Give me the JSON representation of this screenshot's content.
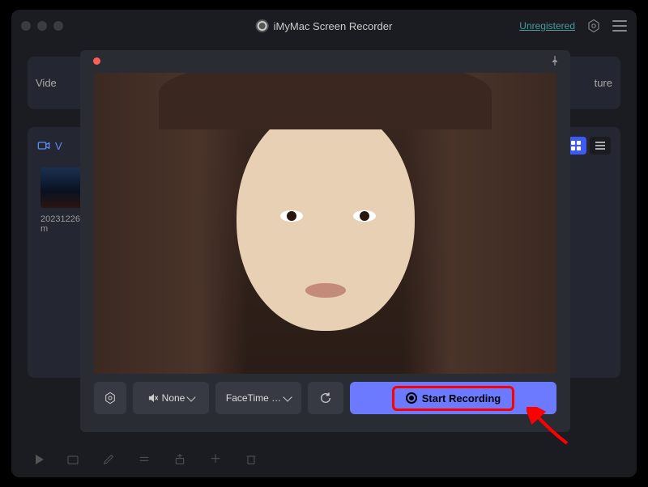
{
  "titlebar": {
    "app_name": "iMyMac Screen Recorder",
    "unregistered_label": "Unregistered"
  },
  "tabs": {
    "video_label": "Vide",
    "capture_label": "ture"
  },
  "section": {
    "header_prefix": "V",
    "filename_line1": "20231226",
    "filename_line2": "m"
  },
  "modal": {
    "audio_label": "None",
    "camera_label": "FaceTime …",
    "start_label": "Start Recording"
  }
}
